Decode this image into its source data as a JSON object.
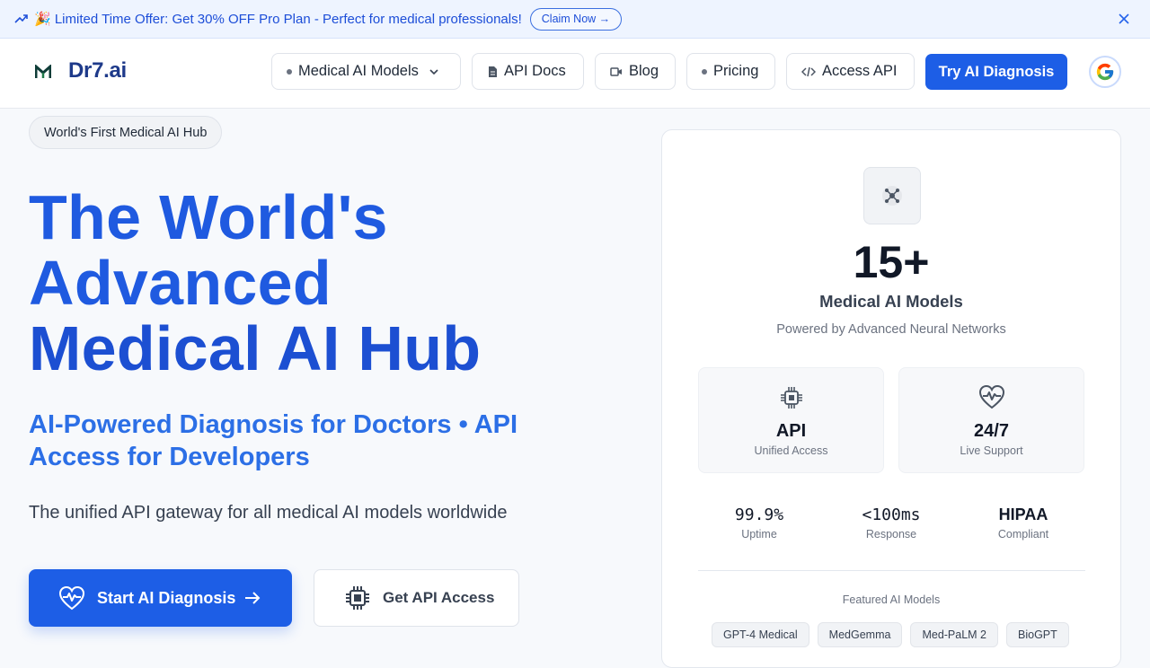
{
  "promo": {
    "message": "🎉 Limited Time Offer: Get 30% OFF Pro Plan - Perfect for medical professionals!",
    "claim_label": "Claim Now →"
  },
  "brand": {
    "name": "Dr7.ai"
  },
  "nav": {
    "items": [
      {
        "label": "Medical AI Models",
        "icon": "dot",
        "has_dropdown": true
      },
      {
        "label": "API Docs",
        "icon": "document-icon"
      },
      {
        "label": "Blog",
        "icon": "video-icon"
      },
      {
        "label": "Pricing",
        "icon": "dot"
      },
      {
        "label": "Access API",
        "icon": "code-icon"
      }
    ],
    "cta_label": "Try AI Diagnosis",
    "account_icon": "google-icon"
  },
  "hero": {
    "badge": "World's First Medical AI Hub",
    "headline_lines": [
      "The World's",
      "Advanced",
      "Medical AI Hub"
    ],
    "subheadline": "AI-Powered Diagnosis for Doctors • API Access for Developers",
    "description": "The unified API gateway for all medical AI models worldwide",
    "primary_button": "Start AI Diagnosis",
    "secondary_button": "Get API Access"
  },
  "stats_card": {
    "count": "15+",
    "count_label": "Medical AI Models",
    "powered_by": "Powered by Advanced Neural Networks",
    "tiles": [
      {
        "value": "API",
        "label": "Unified Access",
        "icon": "chip-icon"
      },
      {
        "value": "24/7",
        "label": "Live Support",
        "icon": "heart-pulse-icon"
      }
    ],
    "metrics": [
      {
        "value": "99.9%",
        "label": "Uptime"
      },
      {
        "value": "<100ms",
        "label": "Response"
      },
      {
        "value": "HIPAA",
        "label": "Compliant"
      }
    ],
    "featured_title": "Featured AI Models",
    "featured_models": [
      "GPT-4 Medical",
      "MedGemma",
      "Med-PaLM 2",
      "BioGPT"
    ]
  },
  "colors": {
    "primary": "#1d5ee6",
    "headline": "#1f5ae0",
    "brand_text": "#1e3a8a",
    "banner_bg": "#eef4ff"
  }
}
